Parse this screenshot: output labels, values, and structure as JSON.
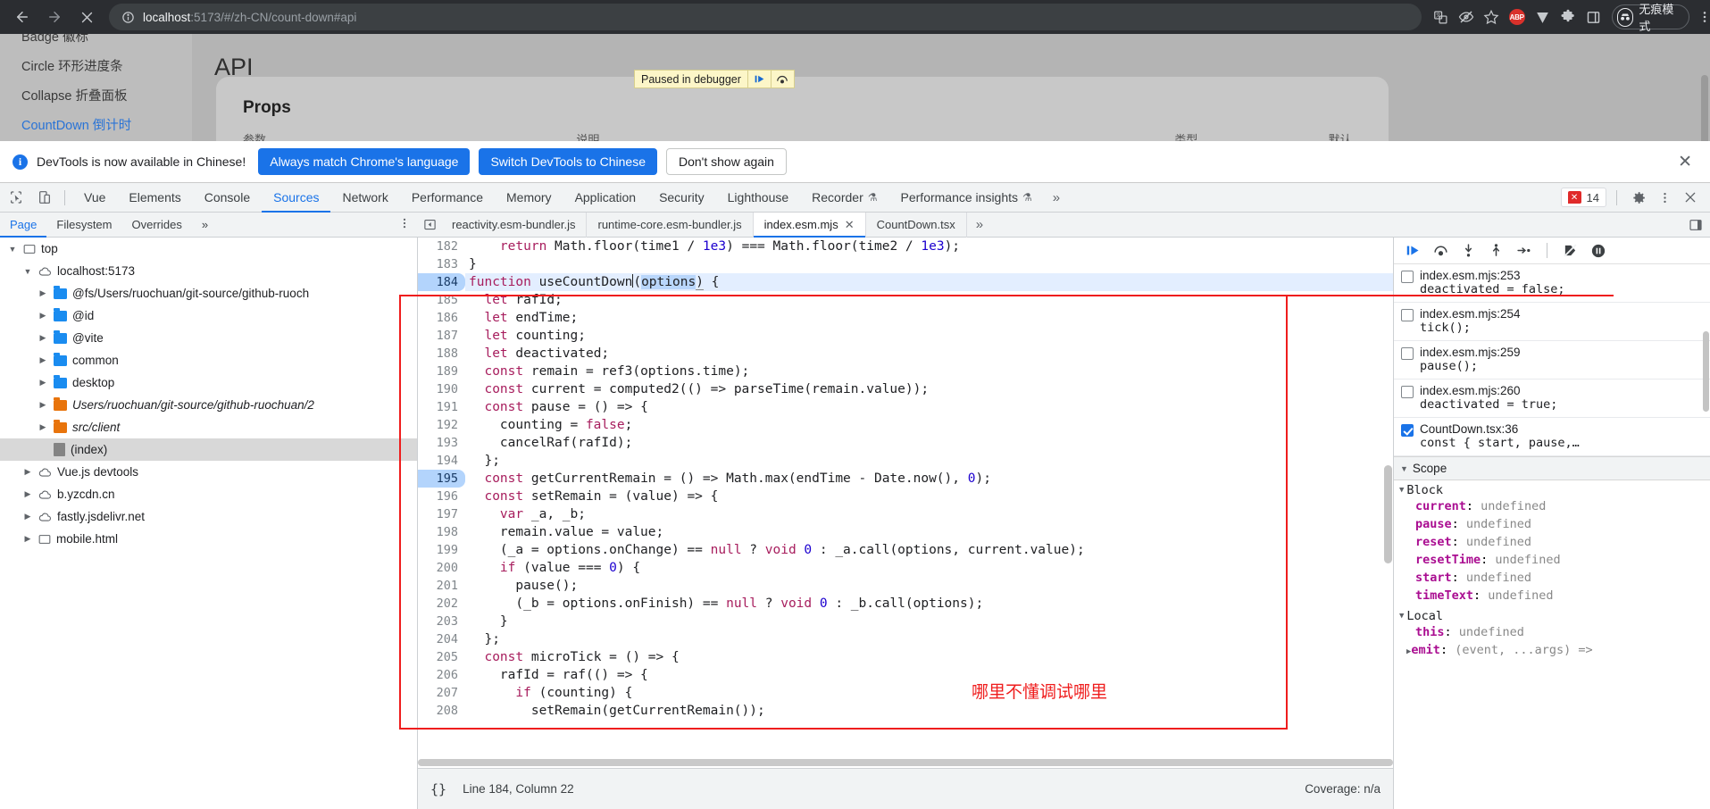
{
  "browser": {
    "back_icon": "arrow-left-icon",
    "forward_icon": "arrow-right-icon",
    "stop_icon": "close-icon",
    "site_info_icon": "info-circle-icon",
    "url_host": "localhost",
    "url_path": ":5173/#/zh-CN/count-down#api",
    "url_full": "localhost:5173/#/zh-CN/count-down#api",
    "toolbar_icons": [
      "translate-icon",
      "eye-slash-icon",
      "star-icon",
      "adblock-icon",
      "vimium-icon",
      "extensions-puzzle-icon",
      "side-panel-icon"
    ],
    "adblock_label": "ABP",
    "incognito_label": "无痕模式",
    "menu_icon": "three-dots-vertical-icon"
  },
  "page": {
    "sidebar_items": [
      {
        "label": "Badge 徽标",
        "active": false
      },
      {
        "label": "Circle 环形进度条",
        "active": false
      },
      {
        "label": "Collapse 折叠面板",
        "active": false
      },
      {
        "label": "CountDown 倒计时",
        "active": true
      }
    ],
    "title": "API",
    "props_title": "Props",
    "props_columns": [
      "参数",
      "说明",
      "类型",
      "默认值"
    ],
    "paused_banner": "Paused in debugger",
    "paused_resume_icon": "resume-icon",
    "paused_step_icon": "step-over-icon"
  },
  "notification": {
    "icon": "info-icon",
    "message": "DevTools is now available in Chinese!",
    "primary_button": "Always match Chrome's language",
    "secondary_button": "Switch DevTools to Chinese",
    "tertiary_button": "Don't show again",
    "close_icon": "close-icon"
  },
  "devtools": {
    "inspect_icon": "inspect-cursor-icon",
    "device_icon": "device-toolbar-icon",
    "tabs": [
      {
        "label": "Vue",
        "active": false,
        "experimental": false
      },
      {
        "label": "Elements",
        "active": false,
        "experimental": false
      },
      {
        "label": "Console",
        "active": false,
        "experimental": false
      },
      {
        "label": "Sources",
        "active": true,
        "experimental": false
      },
      {
        "label": "Network",
        "active": false,
        "experimental": false
      },
      {
        "label": "Performance",
        "active": false,
        "experimental": false
      },
      {
        "label": "Memory",
        "active": false,
        "experimental": false
      },
      {
        "label": "Application",
        "active": false,
        "experimental": false
      },
      {
        "label": "Security",
        "active": false,
        "experimental": false
      },
      {
        "label": "Lighthouse",
        "active": false,
        "experimental": false
      },
      {
        "label": "Recorder",
        "active": false,
        "experimental": true
      },
      {
        "label": "Performance insights",
        "active": false,
        "experimental": true
      }
    ],
    "more_tabs_icon": "chevron-double-right-icon",
    "error_count": "14",
    "error_icon": "error-badge-icon",
    "settings_icon": "gear-icon",
    "kebab_icon": "three-dots-vertical-icon",
    "close_icon": "close-icon"
  },
  "sources": {
    "nav_tabs": [
      {
        "label": "Page",
        "active": true
      },
      {
        "label": "Filesystem",
        "active": false
      },
      {
        "label": "Overrides",
        "active": false
      }
    ],
    "nav_more_icon": "chevron-double-right-icon",
    "nav_kebab_icon": "three-dots-vertical-icon",
    "jump_icon": "show-navigator-icon",
    "file_tabs": [
      {
        "label": "reactivity.esm-bundler.js",
        "active": false,
        "closable": false
      },
      {
        "label": "runtime-core.esm-bundler.js",
        "active": false,
        "closable": false
      },
      {
        "label": "index.esm.mjs",
        "active": true,
        "closable": true
      },
      {
        "label": "CountDown.tsx",
        "active": false,
        "closable": false
      }
    ],
    "file_tabs_more_icon": "chevron-double-right-icon",
    "dock_icon": "dock-to-right-icon",
    "tree": [
      {
        "label": "top",
        "depth": 0,
        "icon": "frame-icon",
        "expanded": true,
        "selected": false
      },
      {
        "label": "localhost:5173",
        "depth": 1,
        "icon": "cloud-icon",
        "expanded": true,
        "selected": false
      },
      {
        "label": "@fs/Users/ruochuan/git-source/github-ruoch",
        "depth": 2,
        "icon": "folder-blue",
        "expanded": false,
        "selected": false
      },
      {
        "label": "@id",
        "depth": 2,
        "icon": "folder-blue",
        "expanded": false,
        "selected": false
      },
      {
        "label": "@vite",
        "depth": 2,
        "icon": "folder-blue",
        "expanded": false,
        "selected": false
      },
      {
        "label": "common",
        "depth": 2,
        "icon": "folder-blue",
        "expanded": false,
        "selected": false
      },
      {
        "label": "desktop",
        "depth": 2,
        "icon": "folder-blue",
        "expanded": false,
        "selected": false
      },
      {
        "label": "Users/ruochuan/git-source/github-ruochuan/2",
        "depth": 2,
        "icon": "folder-orange",
        "italic": true,
        "expanded": false,
        "selected": false
      },
      {
        "label": "src/client",
        "depth": 2,
        "icon": "folder-orange",
        "italic": true,
        "expanded": false,
        "selected": false
      },
      {
        "label": "(index)",
        "depth": 2,
        "icon": "document-icon",
        "expanded": false,
        "selected": true
      },
      {
        "label": "Vue.js devtools",
        "depth": 1,
        "icon": "cloud-icon",
        "expanded": false,
        "selected": false
      },
      {
        "label": "b.yzcdn.cn",
        "depth": 1,
        "icon": "cloud-icon",
        "expanded": false,
        "selected": false
      },
      {
        "label": "fastly.jsdelivr.net",
        "depth": 1,
        "icon": "cloud-icon",
        "expanded": false,
        "selected": false
      },
      {
        "label": "mobile.html",
        "depth": 1,
        "icon": "frame-icon",
        "expanded": false,
        "selected": false
      }
    ]
  },
  "code": {
    "annotation_note": "哪里不懂调试哪里",
    "lines": [
      {
        "no": "182",
        "text": "    return Math.floor(time1 / 1e3) === Math.floor(time2 / 1e3);",
        "clipped": true
      },
      {
        "no": "183",
        "text": "}"
      },
      {
        "no": "184",
        "text": "function useCountDown(options) {",
        "breakpoint": true,
        "executing": true
      },
      {
        "no": "185",
        "text": "  let rafId;"
      },
      {
        "no": "186",
        "text": "  let endTime;"
      },
      {
        "no": "187",
        "text": "  let counting;"
      },
      {
        "no": "188",
        "text": "  let deactivated;"
      },
      {
        "no": "189",
        "text": "  const remain = ref3(options.time);"
      },
      {
        "no": "190",
        "text": "  const current = computed2(() => parseTime(remain.value));"
      },
      {
        "no": "191",
        "text": "  const pause = () => {"
      },
      {
        "no": "192",
        "text": "    counting = false;"
      },
      {
        "no": "193",
        "text": "    cancelRaf(rafId);"
      },
      {
        "no": "194",
        "text": "  };"
      },
      {
        "no": "195",
        "text": "  const getCurrentRemain = () => Math.max(endTime - Date.now(), 0);",
        "breakpoint": true
      },
      {
        "no": "196",
        "text": "  const setRemain = (value) => {"
      },
      {
        "no": "197",
        "text": "    var _a, _b;"
      },
      {
        "no": "198",
        "text": "    remain.value = value;"
      },
      {
        "no": "199",
        "text": "    (_a = options.onChange) == null ? void 0 : _a.call(options, current.value);"
      },
      {
        "no": "200",
        "text": "    if (value === 0) {"
      },
      {
        "no": "201",
        "text": "      pause();"
      },
      {
        "no": "202",
        "text": "      (_b = options.onFinish) == null ? void 0 : _b.call(options);"
      },
      {
        "no": "203",
        "text": "    }"
      },
      {
        "no": "204",
        "text": "  };"
      },
      {
        "no": "205",
        "text": "  const microTick = () => {"
      },
      {
        "no": "206",
        "text": "    rafId = raf(() => {"
      },
      {
        "no": "207",
        "text": "      if (counting) {",
        "clipped": true
      },
      {
        "no": "208",
        "text": "        setRemain(getCurrentRemain());"
      }
    ]
  },
  "status": {
    "pretty_print_icon": "{}",
    "position": "Line 184, Column 22",
    "coverage": "Coverage: n/a"
  },
  "debugger": {
    "toolbar_icons": [
      "resume-script-icon",
      "step-over-icon",
      "step-into-icon",
      "step-out-icon",
      "step-icon",
      "deactivate-breakpoints-icon",
      "pause-on-exceptions-icon"
    ],
    "breakpoints": [
      {
        "location": "index.esm.mjs:253",
        "code": "deactivated = false;",
        "checked": false
      },
      {
        "location": "index.esm.mjs:254",
        "code": "tick();",
        "checked": false
      },
      {
        "location": "index.esm.mjs:259",
        "code": "pause();",
        "checked": false
      },
      {
        "location": "index.esm.mjs:260",
        "code": "deactivated = true;",
        "checked": false
      },
      {
        "location": "CountDown.tsx:36",
        "code": "const { start, pause,…",
        "checked": true
      }
    ],
    "scope_title": "Scope",
    "scopes": [
      {
        "name": "Block",
        "expanded": true,
        "vars": [
          {
            "key": "current",
            "value": "undefined"
          },
          {
            "key": "pause",
            "value": "undefined"
          },
          {
            "key": "reset",
            "value": "undefined"
          },
          {
            "key": "resetTime",
            "value": "undefined"
          },
          {
            "key": "start",
            "value": "undefined"
          },
          {
            "key": "timeText",
            "value": "undefined"
          }
        ]
      },
      {
        "name": "Local",
        "expanded": true,
        "vars": [
          {
            "key": "this",
            "value": "undefined"
          },
          {
            "key": "emit",
            "value": "(event, ...args) =>",
            "expandable": true
          }
        ]
      }
    ]
  },
  "colors": {
    "accent_blue": "#1a73e8",
    "annotation_red": "#ef1d1d",
    "breakpoint_blue": "#b3d4fc",
    "keyword_pink": "#a71d5d",
    "number_blue": "#1c00cf",
    "scope_key_magenta": "#aa0d91"
  }
}
